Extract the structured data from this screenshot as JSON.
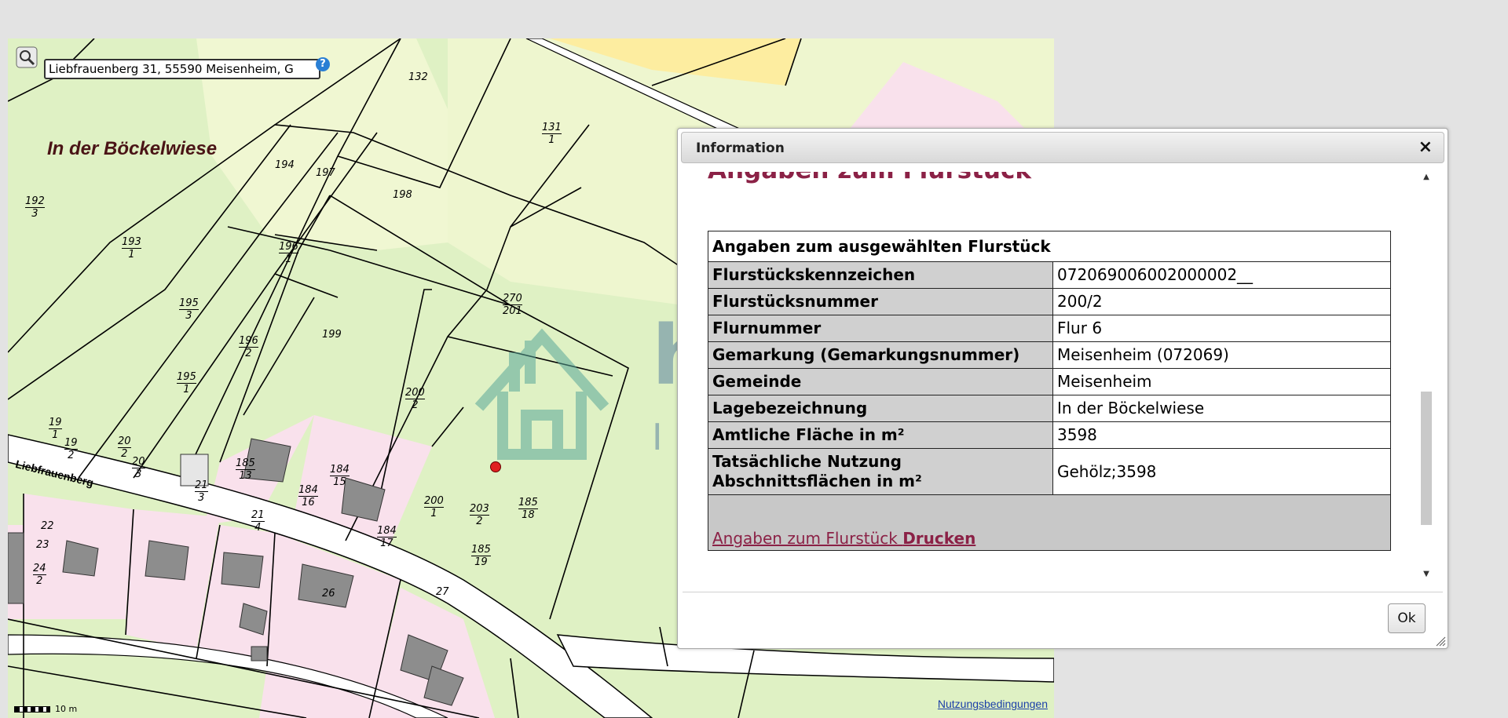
{
  "map": {
    "search_value": "Liebfrauenberg 31, 55590 Meisenheim, G",
    "help_symbol": "?",
    "area_label": "In der Böckelwiese",
    "street_label": "Liebfrauenberg",
    "parcel_labels": [
      {
        "top": "132",
        "bottom": ""
      },
      {
        "top": "131",
        "bottom": "1"
      },
      {
        "top": "192",
        "bottom": "3"
      },
      {
        "top": "193",
        "bottom": "1"
      },
      {
        "top": "194",
        "bottom": ""
      },
      {
        "top": "197",
        "bottom": ""
      },
      {
        "top": "198",
        "bottom": ""
      },
      {
        "top": "196",
        "bottom": "1"
      },
      {
        "top": "195",
        "bottom": "3"
      },
      {
        "top": "270",
        "bottom": "201"
      },
      {
        "top": "196",
        "bottom": "2"
      },
      {
        "top": "199",
        "bottom": ""
      },
      {
        "top": "195",
        "bottom": "1"
      },
      {
        "top": "200",
        "bottom": "2"
      },
      {
        "top": "19",
        "bottom": "1"
      },
      {
        "top": "19",
        "bottom": "2"
      },
      {
        "top": "20",
        "bottom": "2"
      },
      {
        "top": "20",
        "bottom": "3"
      },
      {
        "top": "21",
        "bottom": "3"
      },
      {
        "top": "185",
        "bottom": "13"
      },
      {
        "top": "184",
        "bottom": "15"
      },
      {
        "top": "184",
        "bottom": "16"
      },
      {
        "top": "21",
        "bottom": "4"
      },
      {
        "top": "200",
        "bottom": "1"
      },
      {
        "top": "203",
        "bottom": "2"
      },
      {
        "top": "185",
        "bottom": "18"
      },
      {
        "top": "184",
        "bottom": "17"
      },
      {
        "top": "185",
        "bottom": "19"
      },
      {
        "top": "22",
        "bottom": ""
      },
      {
        "top": "23",
        "bottom": ""
      },
      {
        "top": "24",
        "bottom": "2"
      },
      {
        "top": "26",
        "bottom": ""
      },
      {
        "top": "27",
        "bottom": ""
      }
    ],
    "scale_label": "10 m",
    "terms_link": "Nutzungsbedingungen",
    "watermark": {
      "line1": "handschuh",
      "line2": "IMMOBILIEN"
    }
  },
  "dialog": {
    "title": "Information",
    "close_symbol": "×",
    "heading": "Angaben zum Flurstück",
    "table_header": "Angaben zum ausgewählten Flurstück",
    "rows": [
      {
        "key": "Flurstückskennzeichen",
        "value": "072069006002000002__"
      },
      {
        "key": "Flurstücksnummer",
        "value": "200/2"
      },
      {
        "key": "Flurnummer",
        "value": "Flur 6"
      },
      {
        "key": "Gemarkung (Gemarkungsnummer)",
        "value": "Meisenheim (072069)"
      },
      {
        "key": "Gemeinde",
        "value": "Meisenheim"
      },
      {
        "key": "Lagebezeichnung",
        "value": "In der Böckelwiese"
      },
      {
        "key": "Amtliche Fläche in m²",
        "value": "3598"
      },
      {
        "key": "Tatsächliche Nutzung Abschnittsflächen in m²",
        "value": "Gehölz;3598"
      }
    ],
    "print_link_prefix": "Angaben zum Flurstück ",
    "print_link_bold": "Drucken",
    "ok_label": "Ok"
  },
  "colors": {
    "meadow": "#dff1c4",
    "grass_light": "#f0f7d2",
    "residential": "#f9e1ec",
    "building": "#8d8d8d",
    "yellow_area": "#fdeda0",
    "heading": "#8b2146",
    "watermark": "#5c84a0",
    "watermark_icon": "#5aa89a"
  }
}
